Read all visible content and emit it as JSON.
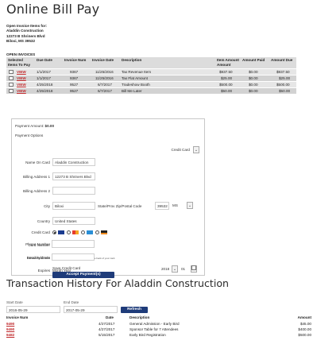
{
  "title": "Online Bill Pay",
  "open_invoices_for": [
    "Open Invoice Items for:",
    "Aladdin Construction",
    "12273 B Shriners Blvd",
    "Biloxi, MS 39532"
  ],
  "open_invoices_label": "OPEN INVOICES",
  "invoice_headers": {
    "selected": "Selected",
    "items_to_pay": "Items To Pay",
    "due_date": "Due Date",
    "invoice_num": "Invoice Num",
    "invoice_date": "Invoice Date",
    "description": "Description",
    "item_amount": "Item Amount",
    "amount": "Amount",
    "amount_paid": "Amount Paid",
    "amount_due": "Amount Due"
  },
  "invoices": [
    {
      "view": "VIEW",
      "due": "1/1/2017",
      "num": "9367",
      "date": "11/25/2016",
      "desc": "Tax Revenue Item",
      "item_amount": "$937.50",
      "paid": "$0.00",
      "due_amt": "$937.50"
    },
    {
      "view": "VIEW",
      "due": "1/1/2017",
      "num": "9367",
      "date": "11/25/2016",
      "desc": "Tax Flat Amount",
      "item_amount": "$25.00",
      "paid": "$0.00",
      "due_amt": "$25.00"
    },
    {
      "view": "VIEW",
      "due": "4/25/2018",
      "num": "9527",
      "date": "6/7/2017",
      "desc": "Tradeshow Booth",
      "item_amount": "$500.00",
      "paid": "$0.00",
      "due_amt": "$500.00"
    },
    {
      "view": "VIEW",
      "due": "4/25/2018",
      "num": "9527",
      "date": "6/7/2017",
      "desc": "Bill Me Later",
      "item_amount": "$50.00",
      "paid": "$0.00",
      "due_amt": "$50.00"
    }
  ],
  "payment": {
    "amount_label": "Payment Amount:",
    "amount_value": "$0.00",
    "options_label": "Payment Options",
    "options_value": "Credit Card",
    "name_label": "Name On Card",
    "name_value": "Aladdin Construction",
    "addr1_label": "Billing Address 1",
    "addr1_value": "12273 B Shriners Blvd",
    "addr2_label": "Billing Address 2",
    "addr2_value": "",
    "city_label": "City",
    "city_value": "Biloxi",
    "state_label": "State/Prov Zip/Postal Code",
    "zip_value": "39532",
    "state_value": "MS",
    "country_label": "Country",
    "country_value": "United States",
    "card_label": "Credit Card",
    "card_number_label": "Card Number",
    "security_label": "Security Code",
    "security_hint": "← This is the 3-4 digit code on the back of your card.",
    "expires_label": "Expires",
    "expires_hint": "Month Year",
    "exp_year": "2018",
    "exp_month": "01",
    "phone_label": "Phone Number",
    "email_label": "Email Address",
    "save_label": "Save Credit Card",
    "accept_label": "Accept Payment(s)"
  },
  "history": {
    "title": "Transaction History For Aladdin Construction",
    "start_label": "Start Date",
    "start_value": "2016-05-29",
    "end_label": "End Date",
    "end_value": "2017-05-29",
    "refresh_label": "Refresh",
    "headers": {
      "invoice": "Invoice Num",
      "date": "Date",
      "description": "Description",
      "amount": "Amount"
    },
    "rows": [
      {
        "invoice": "9490",
        "date": "4/27/2017",
        "description": "General Admission - Early Bird",
        "amount": "$45.00"
      },
      {
        "invoice": "9490",
        "date": "4/27/2017",
        "description": "Sponsor Table for 7 Attendees",
        "amount": "$400.00"
      },
      {
        "invoice": "9482",
        "date": "5/15/2017",
        "description": "Early Bird Registration",
        "amount": "$500.00"
      }
    ]
  },
  "colors": {
    "accent": "#1f3c7a",
    "link": "#c0282b",
    "header_bg": "#dcdcdc"
  }
}
